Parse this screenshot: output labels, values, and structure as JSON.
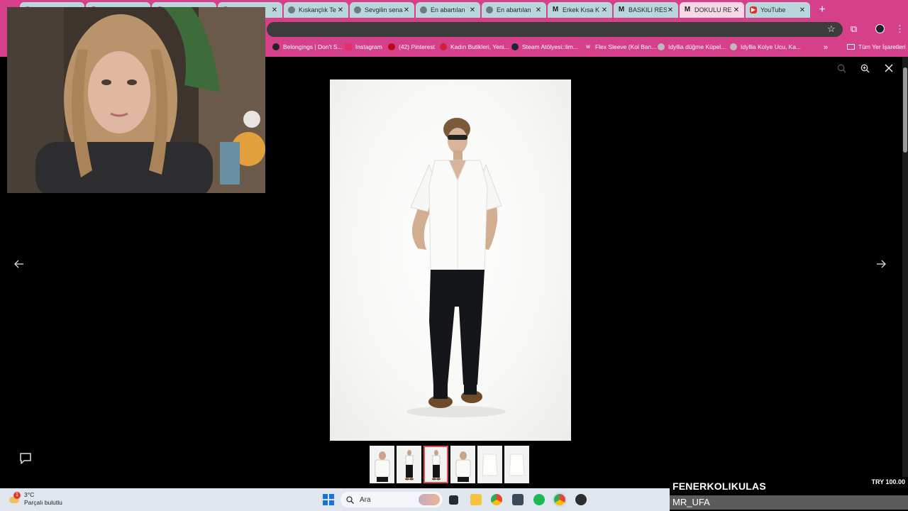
{
  "browser": {
    "tabs": [
      {
        "label": "",
        "icon": "pink-site-icon"
      },
      {
        "label": "",
        "icon": "pink-site-icon"
      },
      {
        "label": "",
        "icon": "pink-site-icon"
      },
      {
        "label": "",
        "icon": "site-icon"
      },
      {
        "label": "Kıskançlık Te",
        "icon": "globe-icon"
      },
      {
        "label": "Sevgilin sena",
        "icon": "globe-icon"
      },
      {
        "label": "En abartılan",
        "icon": "globe-icon"
      },
      {
        "label": "En abartılan",
        "icon": "globe-icon"
      },
      {
        "label": "Erkek Kısa K",
        "icon": "m-icon"
      },
      {
        "label": "BASKILI RES",
        "icon": "m-icon"
      },
      {
        "label": "DOKULU RE",
        "icon": "m-icon",
        "active": true
      },
      {
        "label": "YouTube",
        "icon": "youtube-icon"
      }
    ],
    "bookmarks": [
      "Belongings | Don't S...",
      "Instagram",
      "(42) Pinterest",
      "Kadın Butikleri, Yeni...",
      "Steam Atölyesi::lim...",
      "Flex Sleeve (Kol Ban...",
      "Idyllia düğme Küpel...",
      "Idyllia Kolye Ucu, Ka..."
    ],
    "bookmarks_folder": "Tüm Yer İşaretleri",
    "accent_color": "#d63f8a"
  },
  "viewer": {
    "thumbnail_count": 6,
    "selected_thumbnail": 3
  },
  "taskbar": {
    "weather_temp": "3°C",
    "weather_desc": "Parçalı bulutlu",
    "weather_badge": "1",
    "search_placeholder": "Ara"
  },
  "donation": {
    "name": "FENERKOLIKULAS",
    "amount": "TRY 100.00",
    "user": "MR_UFA"
  }
}
